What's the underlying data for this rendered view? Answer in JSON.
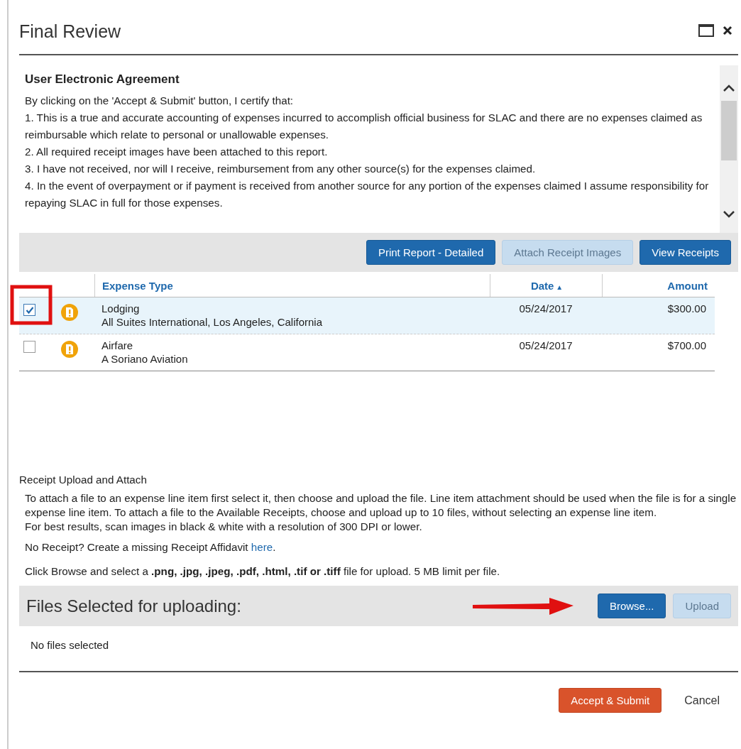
{
  "window": {
    "title": "Final Review"
  },
  "agreement": {
    "heading": "User Electronic Agreement",
    "lines": [
      "By clicking on the 'Accept & Submit' button, I certify that:",
      "1. This is a true and accurate accounting of expenses incurred to accomplish official business for SLAC and there are no expenses claimed as reimbursable which relate to personal or unallowable expenses.",
      "2. All required receipt images have been attached to this report.",
      "3. I have not received, nor will I receive, reimbursement from any other source(s) for the expenses claimed.",
      "4. In the event of overpayment or if payment is received from another source for any portion of the expenses claimed I assume responsibility for repaying SLAC in full for those expenses."
    ]
  },
  "toolbar": {
    "buttons": [
      {
        "label": "Print Report - Detailed",
        "disabled": false
      },
      {
        "label": "Attach Receipt Images",
        "disabled": true
      },
      {
        "label": "View Receipts",
        "disabled": false
      }
    ]
  },
  "table": {
    "columns": [
      {
        "label": "Expense Type"
      },
      {
        "label": "Date",
        "sort_indicator": "▲"
      },
      {
        "label": "Amount"
      }
    ],
    "rows": [
      {
        "selected": true,
        "checked": true,
        "expense_type": "Lodging",
        "vendor": "All Suites International, Los Angeles, California",
        "date": "05/24/2017",
        "amount": "$300.00"
      },
      {
        "selected": false,
        "checked": false,
        "expense_type": "Airfare",
        "vendor": "A Soriano Aviation",
        "date": "05/24/2017",
        "amount": "$700.00"
      }
    ]
  },
  "receipt": {
    "heading": "Receipt Upload and Attach",
    "paragraphs": [
      "To attach a file to an expense line item first select it, then choose and upload the file. Line item attachment should be used when the file is for a single expense line item. To attach a file to the Available Receipts, choose and upload up to 10 files, without selecting an expense line item.",
      "For best results, scan images in black & white with a resolution of 300 DPI or lower."
    ],
    "affidavit": {
      "text": "No Receipt? Create a missing Receipt Affidavit ",
      "link": "here",
      "after": "."
    },
    "browse_hint": "Click Browse and select a **.png, .jpg, .jpeg, .pdf, .html, .tif or .tiff** file for upload. 5 MB limit per file."
  },
  "files": {
    "title": "Files Selected for uploading:",
    "buttons": [
      {
        "label": "Browse...",
        "disabled": false
      },
      {
        "label": "Upload",
        "disabled": true
      }
    ],
    "empty_text": "No files selected"
  },
  "footer": {
    "buttons": [
      {
        "label": "Accept & Submit",
        "kind": "primary"
      },
      {
        "label": "Cancel",
        "kind": "link"
      }
    ]
  }
}
